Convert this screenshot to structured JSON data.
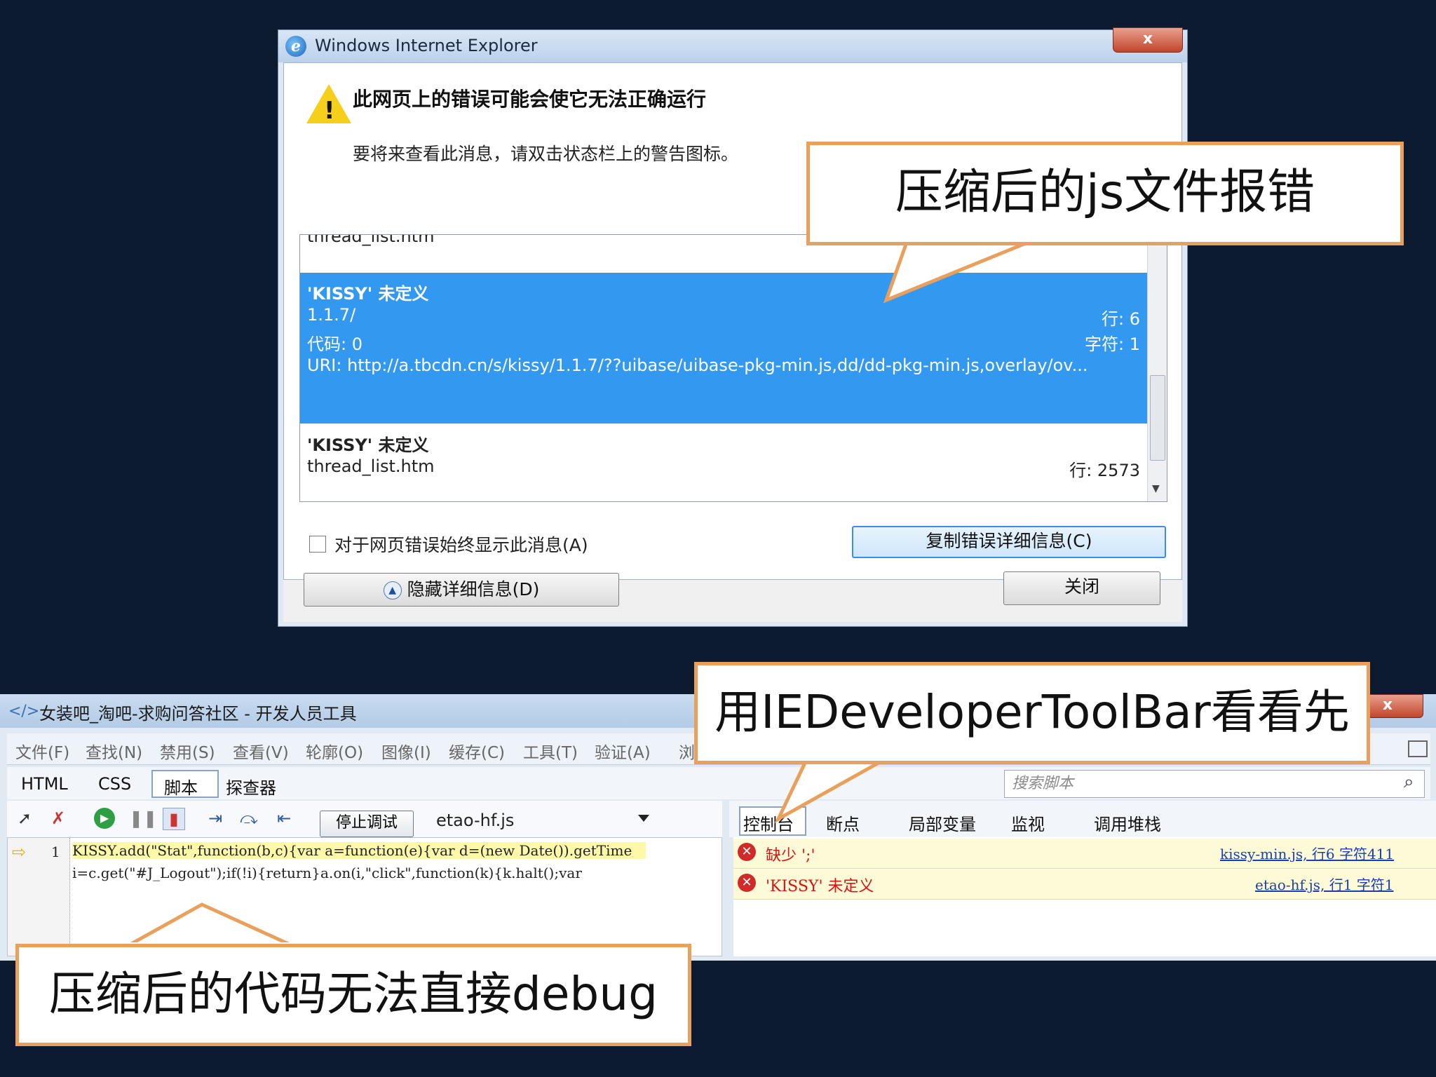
{
  "ie_dialog": {
    "title": "Windows Internet Explorer",
    "close_glyph": "x",
    "heading": "此网页上的错误可能会使它无法正确运行",
    "subtext": "要将来查看此消息，请双击状态栏上的警告图标。",
    "errors": [
      {
        "file_top": "thread_list.htm"
      },
      {
        "name": "'KISSY' 未定义",
        "url": "1.1.7/",
        "line": "行: 6",
        "code": "代码: 0",
        "char": "字符: 1",
        "uri": "URI: http://a.tbcdn.cn/s/kissy/1.1.7/??uibase/uibase-pkg-min.js,dd/dd-pkg-min.js,overlay/ov..."
      },
      {
        "name": "'KISSY' 未定义",
        "url": "thread_list.htm",
        "line": "行: 2573"
      }
    ],
    "always_show_label": "对于网页错误始终显示此消息(A)",
    "copy_button": "复制错误详细信息(C)",
    "hide_details_button": "隐藏详细信息(D)",
    "close_button": "关闭"
  },
  "callouts": {
    "compressed_js_error": "压缩后的js文件报错",
    "use_toolbar": "用IEDeveloperToolBar看看先",
    "cannot_debug": "压缩后的代码无法直接debug"
  },
  "devtools": {
    "title": "女装吧_淘吧-求购问答社区 - 开发人员工具",
    "close_glyph": "x",
    "menu": [
      "文件(F)",
      "查找(N)",
      "禁用(S)",
      "查看(V)",
      "轮廓(O)",
      "图像(I)",
      "缓存(C)",
      "工具(T)",
      "验证(A)",
      "浏"
    ],
    "tabs": [
      "HTML",
      "CSS",
      "脚本",
      "探查器"
    ],
    "search_placeholder": "搜索脚本",
    "stop_debug_button": "停止调试",
    "file_name": "etao-hf.js",
    "line_number": "1",
    "code_line_1": "KISSY.add(\"Stat\",function(b,c){var a=function(e){var d=(new Date()).getTime",
    "code_line_2": "i=c.get(\"#J_Logout\");if(!i){return}a.on(i,\"click\",function(k){k.halt();var",
    "right_tabs": [
      "控制台",
      "断点",
      "局部变量",
      "监视",
      "调用堆栈"
    ],
    "console": [
      {
        "message": "缺少 ';'",
        "location": "kissy-min.js, 行6 字符411"
      },
      {
        "message": "'KISSY' 未定义",
        "location": "etao-hf.js, 行1 字符1"
      }
    ]
  },
  "colors": {
    "selection": "#3399f0",
    "callout_border": "#e8a05c",
    "background": "#0d1b30"
  }
}
